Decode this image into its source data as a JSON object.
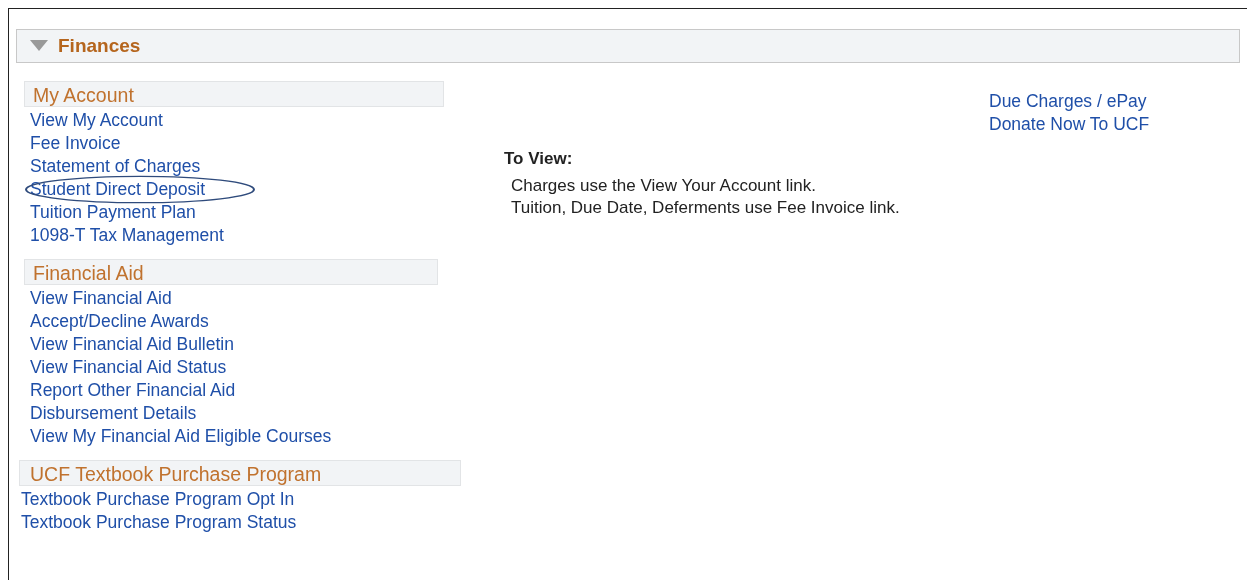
{
  "panel": {
    "title": "Finances",
    "expanded": true
  },
  "sections": [
    {
      "title": "My Account",
      "links": [
        {
          "label": "View My Account",
          "highlighted": false
        },
        {
          "label": "Fee Invoice",
          "highlighted": false
        },
        {
          "label": "Statement of Charges",
          "highlighted": false
        },
        {
          "label": "Student Direct Deposit",
          "highlighted": true
        },
        {
          "label": "Tuition Payment Plan",
          "highlighted": false
        },
        {
          "label": "1098-T Tax Management",
          "highlighted": false
        }
      ]
    },
    {
      "title": "Financial Aid",
      "links": [
        {
          "label": "View Financial Aid",
          "highlighted": false
        },
        {
          "label": "Accept/Decline Awards",
          "highlighted": false
        },
        {
          "label": "View Financial Aid Bulletin",
          "highlighted": false
        },
        {
          "label": "View Financial Aid Status",
          "highlighted": false
        },
        {
          "label": "Report Other Financial Aid",
          "highlighted": false
        },
        {
          "label": "Disbursement Details",
          "highlighted": false
        },
        {
          "label": "View My Financial Aid Eligible Courses",
          "highlighted": false
        }
      ]
    },
    {
      "title": "UCF Textbook Purchase Program",
      "links": [
        {
          "label": "Textbook Purchase Program Opt In",
          "highlighted": false
        },
        {
          "label": "Textbook Purchase Program Status",
          "highlighted": false
        }
      ]
    }
  ],
  "info": {
    "heading": "To View:",
    "lines": [
      "Charges use the View Your Account link.",
      "Tuition, Due Date, Deferments use Fee Invoice link."
    ]
  },
  "quick_links": [
    "Due Charges / ePay",
    "Donate Now To UCF"
  ]
}
